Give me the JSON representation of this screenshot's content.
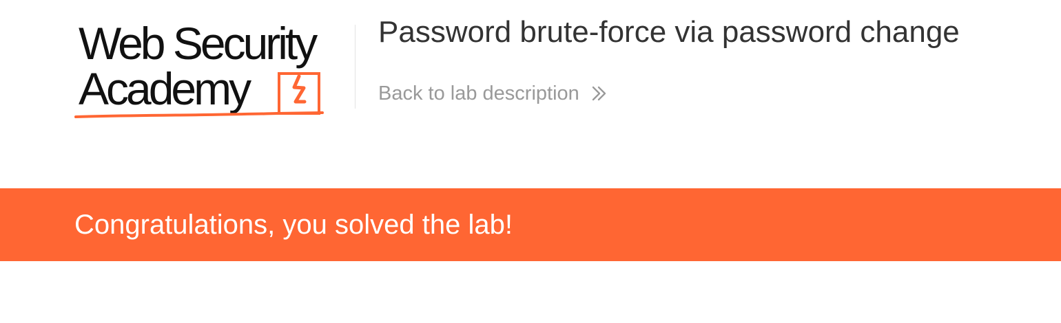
{
  "academy_logo": {
    "line_1": "Web Security",
    "line_2": "Academy"
  },
  "lab": {
    "title": "Password brute-force via password change",
    "back_link_label": "Back to lab description"
  },
  "notification": {
    "message": "Congratulations, you solved the lab!"
  },
  "theme": {
    "accent": "#ff6633",
    "title_text": "#333333",
    "secondary_text": "#999999",
    "banner_text": "#ffffff",
    "divider": "#e3e3e3"
  },
  "icons": {
    "logo_mark": "academy-lightning-mark-icon",
    "back_link": "double-chevron-right-icon"
  }
}
